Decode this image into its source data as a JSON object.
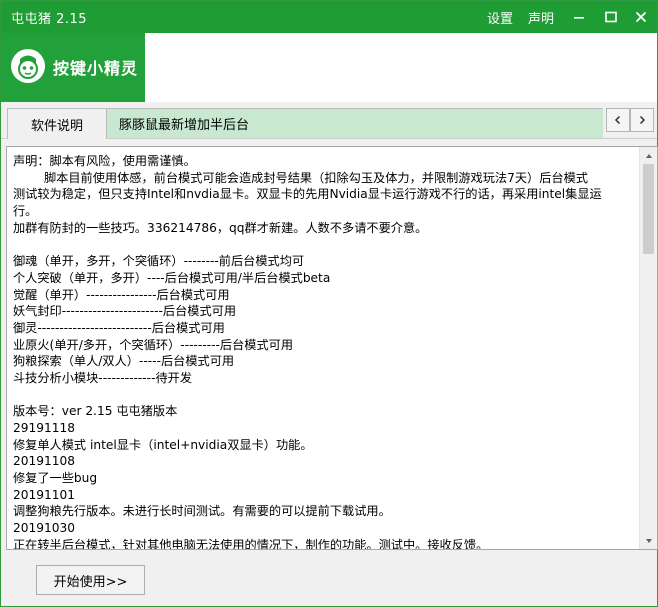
{
  "window": {
    "title": "屯屯猪 2.15",
    "settings_label": "设置",
    "statement_label": "声明",
    "accent_color": "#1f9c34"
  },
  "banner": {
    "brand_text": "按键小精灵",
    "logo_icon": "elf-mascot-icon"
  },
  "tabs": [
    {
      "label": "软件说明",
      "active": true
    },
    {
      "label": "豚豚鼠最新增加半后台",
      "active": false
    }
  ],
  "nav": {
    "prev_icon": "chevron-left-icon",
    "next_icon": "chevron-right-icon"
  },
  "content": {
    "lines": [
      "声明：脚本有风险，使用需谨慎。",
      "        脚本目前使用体感，前台模式可能会造成封号结果（扣除勾玉及体力，并限制游戏玩法7天）后台模式",
      "测试较为稳定，但只支持Intel和nvdia显卡。双显卡的先用Nvidia显卡运行游戏不行的话，再采用intel集显运",
      "行。",
      "加群有防封的一些技巧。336214786，qq群才新建。人数不多请不要介意。",
      "",
      "御魂（单开，多开，个突循环）--------前后台模式均可",
      "个人突破（单开，多开）----后台模式可用/半后台模式beta",
      "觉醒（单开）----------------后台模式可用",
      "妖气封印-----------------------后台模式可用",
      "御灵--------------------------后台模式可用",
      "业原火(单开/多开，个突循环）---------后台模式可用",
      "狗粮探索（单人/双人）-----后台模式可用",
      "斗技分析小模块-------------待开发",
      "",
      "版本号：ver 2.15 屯屯猪版本",
      "29191118",
      "修复单人模式 intel显卡（intel+nvidia双显卡）功能。",
      "20191108",
      "修复了一些bug",
      "20191101",
      "调整狗粮先行版本。未进行长时间测试。有需要的可以提前下载试用。",
      "20191030",
      "正在转半后台模式，针对其他电脑无法使用的情况下，制作的功能。测试中。接收反馈。"
    ]
  },
  "footer": {
    "start_label": "开始使用>>"
  }
}
